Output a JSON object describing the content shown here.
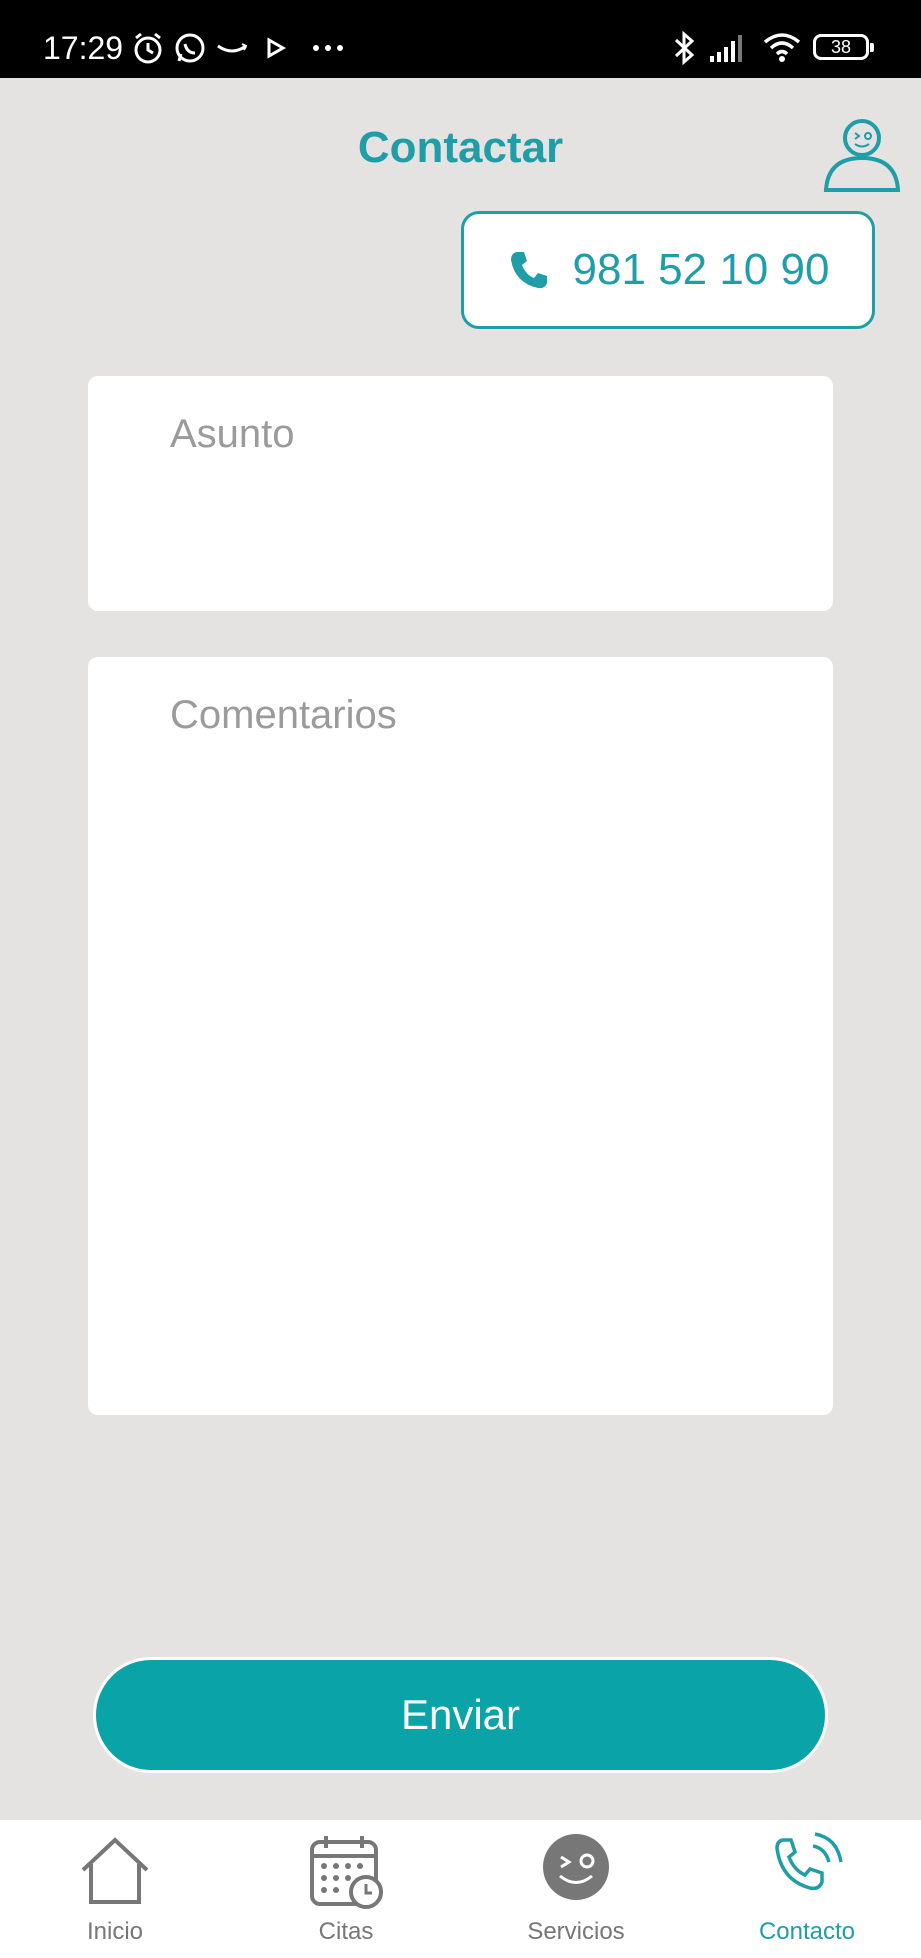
{
  "status_bar": {
    "time": "17:29",
    "battery": "38",
    "icons": [
      "alarm-icon",
      "whatsapp-icon",
      "amazon-icon",
      "play-icon",
      "more-dots-icon",
      "bluetooth-icon",
      "signal-icon",
      "wifi-icon",
      "battery-icon"
    ]
  },
  "header": {
    "title": "Contactar",
    "profile_icon": "user-profile-icon"
  },
  "phone": {
    "icon": "phone-icon",
    "number": "981 52 10 90"
  },
  "form": {
    "asunto_placeholder": "Asunto",
    "comentarios_placeholder": "Comentarios",
    "asunto_value": "",
    "comentarios_value": ""
  },
  "send_button": {
    "label": "Enviar"
  },
  "bottom_nav": {
    "items": [
      {
        "label": "Inicio",
        "icon": "home-icon",
        "active": false
      },
      {
        "label": "Citas",
        "icon": "calendar-clock-icon",
        "active": false
      },
      {
        "label": "Servicios",
        "icon": "smiley-icon",
        "active": false
      },
      {
        "label": "Contacto",
        "icon": "phone-call-icon",
        "active": true
      }
    ]
  },
  "colors": {
    "accent": "#1f9ea8",
    "button": "#0aa3a8",
    "background": "#e4e3e2",
    "inactive": "#777777"
  }
}
